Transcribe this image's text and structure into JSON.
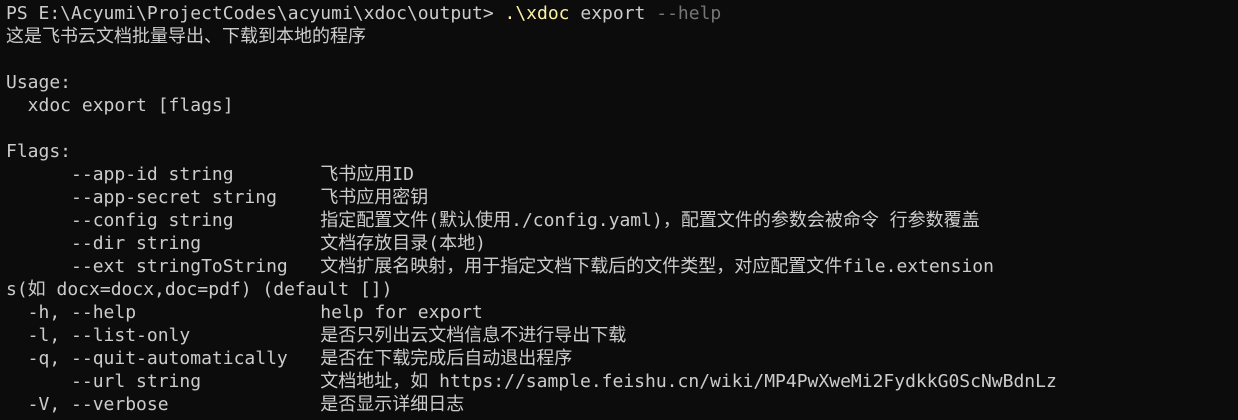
{
  "prompt": {
    "ps": "PS E:\\Acyumi\\ProjectCodes\\acyumi\\xdoc\\output> ",
    "exe": ".\\xdoc",
    "args": " export ",
    "flag": "--help"
  },
  "description": "这是飞书云文档批量导出、下载到本地的程序",
  "usage": {
    "header": "Usage:",
    "command": "  xdoc export [flags]"
  },
  "flags": {
    "header": "Flags:",
    "rows": [
      "      --app-id string        飞书应用ID",
      "      --app-secret string    飞书应用密钥",
      "      --config string        指定配置文件(默认使用./config.yaml)，配置文件的参数会被命令 行参数覆盖",
      "      --dir string           文档存放目录(本地)",
      "      --ext stringToString   文档扩展名映射，用于指定文档下载后的文件类型，对应配置文件file.extension",
      "s(如 docx=docx,doc=pdf) (default [])",
      "  -h, --help                 help for export",
      "  -l, --list-only            是否只列出云文档信息不进行导出下载",
      "  -q, --quit-automatically   是否在下载完成后自动退出程序",
      "      --url string           文档地址，如 https://sample.feishu.cn/wiki/MP4PwXweMi2FydkkG0ScNwBdnLz",
      "  -V, --verbose              是否显示详细日志"
    ]
  },
  "colors": {
    "background": "#0c0c0c",
    "foreground": "#cccccc",
    "command": "#f9f1a5",
    "flag": "#767676"
  }
}
